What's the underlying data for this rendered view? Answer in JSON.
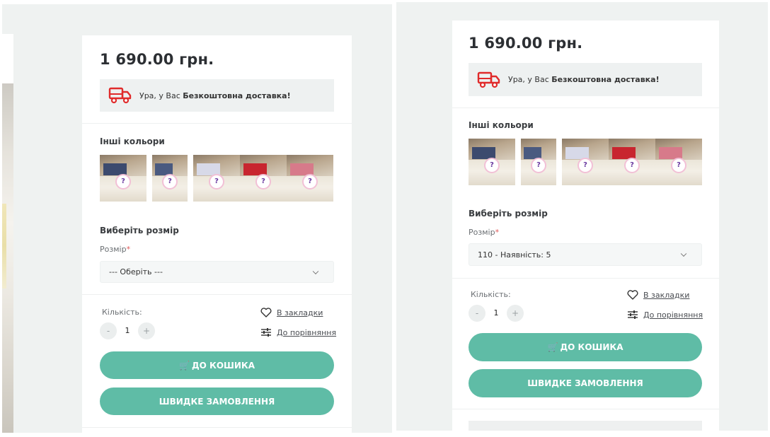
{
  "product": {
    "price": "1 690.00 грн.",
    "delivery_prefix": "Ура, у Вас ",
    "delivery_bold": "Безкоштовна доставка!",
    "colors_title": "Інші кольори",
    "size_title": "Виберіть розмір",
    "size_label": "Розмір",
    "required_mark": "*",
    "qty_label": "Кількість:",
    "qty_value": "1",
    "minus": "-",
    "plus": "+",
    "bookmark_label": "В закладки",
    "compare_label": "До порівняння",
    "cart_label": "ДО КОШИКА",
    "cart_icon": "🛒",
    "quick_order_label": "ШВИДКЕ ЗАМОВЛЕННЯ"
  },
  "left_panel": {
    "size_value": "--- Оберіть ---",
    "thumbnails": [
      {
        "fabric_color": "#3c4a6e"
      },
      {
        "fabric_color": "#4a5a80"
      },
      {
        "fabric_color": "#d7d9e8"
      },
      {
        "fabric_color": "#c8252f"
      },
      {
        "fabric_color": "#d77a8a"
      }
    ]
  },
  "right_panel": {
    "size_value": "110 - Наявність: 5",
    "thumbnails": [
      {
        "fabric_color": "#3c4a6e"
      },
      {
        "fabric_color": "#4a5a80"
      },
      {
        "fabric_color": "#d7d9e8"
      },
      {
        "fabric_color": "#c8252f"
      },
      {
        "fabric_color": "#d77a8a"
      }
    ]
  },
  "icons": {
    "truck": "truck-icon",
    "heart": "heart-icon",
    "compare": "compare-sliders-icon",
    "chevron": "chevron-down-icon",
    "cart": "cart-icon"
  },
  "colors": {
    "accent": "#5fbca6",
    "truck_red": "#e02b2b",
    "page_bg": "#eff2f1",
    "info_bg": "#eef1f1"
  }
}
